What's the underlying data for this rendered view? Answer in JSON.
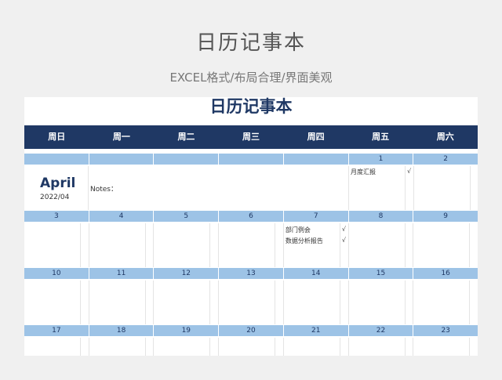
{
  "banner": {
    "title": "日历记事本",
    "subtitle": "EXCEL格式/布局合理/界面美观"
  },
  "sheet": {
    "title": "日历记事本",
    "weekdays": [
      "周日",
      "周一",
      "周二",
      "周三",
      "周四",
      "周五",
      "周六"
    ],
    "month": "April",
    "year_month": "2022/04",
    "notes_label": "Notes：",
    "weeks": [
      [
        "",
        "",
        "",
        "",
        "",
        "1",
        "2"
      ],
      [
        "3",
        "4",
        "5",
        "6",
        "7",
        "8",
        "9"
      ],
      [
        "10",
        "11",
        "12",
        "13",
        "14",
        "15",
        "16"
      ],
      [
        "17",
        "18",
        "19",
        "20",
        "21",
        "22",
        "23"
      ]
    ],
    "tasks": {
      "fri_1": [
        {
          "text": "月度汇报",
          "check": "√"
        }
      ],
      "thu_7": [
        {
          "text": "部门例会",
          "check": "√"
        },
        {
          "text": "数据分析报告",
          "check": "√"
        }
      ]
    }
  },
  "colors": {
    "header_bg": "#1f3864",
    "date_row_bg": "#9dc3e6",
    "title_text": "#1f3864"
  }
}
